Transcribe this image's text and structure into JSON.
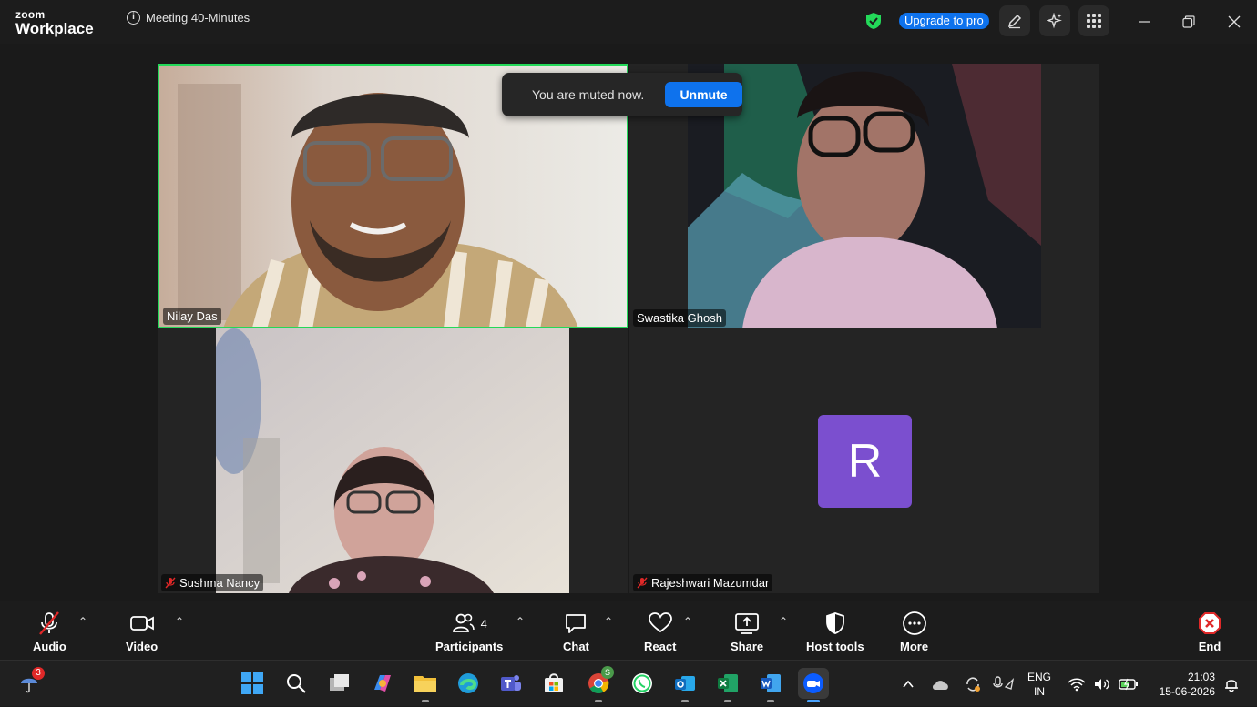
{
  "titlebar": {
    "brand_line1": "zoom",
    "brand_line2": "Workplace",
    "meeting_title": "Meeting 40-Minutes",
    "upgrade_label": "Upgrade to pro"
  },
  "toast": {
    "message": "You are muted now.",
    "action_label": "Unmute"
  },
  "participants": [
    {
      "name": "Nilay Das",
      "muted": false,
      "active_speaker": true
    },
    {
      "name": "Swastika Ghosh",
      "muted": false,
      "active_speaker": false
    },
    {
      "name": "Sushma Nancy",
      "muted": true,
      "active_speaker": false
    },
    {
      "name": "Rajeshwari Mazumdar",
      "muted": true,
      "active_speaker": false,
      "avatar_letter": "R",
      "avatar_color": "#7b4fcf"
    }
  ],
  "toolbar": {
    "audio_label": "Audio",
    "video_label": "Video",
    "participants_label": "Participants",
    "participants_count": "4",
    "chat_label": "Chat",
    "react_label": "React",
    "share_label": "Share",
    "host_tools_label": "Host tools",
    "more_label": "More",
    "end_label": "End"
  },
  "taskbar": {
    "weather_badge": "3",
    "chrome_badge": "S",
    "language_line1": "ENG",
    "language_line2": "IN",
    "time": "21:03",
    "date": "15-06-2026"
  },
  "colors": {
    "accent": "#0e72ed",
    "active_border": "#23d959",
    "end_red": "#e02828",
    "mute_red": "#e02828"
  }
}
